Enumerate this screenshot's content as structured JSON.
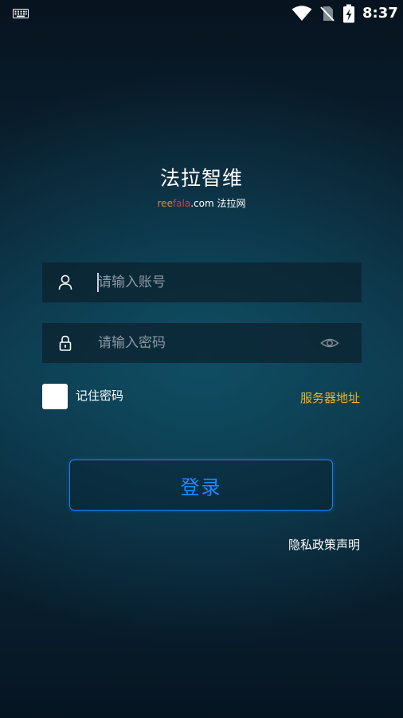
{
  "status_bar": {
    "time": "8:37",
    "icons": [
      "keyboard-icon",
      "wifi-icon",
      "no-sim-icon",
      "battery-charging-icon"
    ]
  },
  "header": {
    "title": "法拉智维",
    "subtitle_ree": "ree",
    "subtitle_fala": "fala",
    "subtitle_rest": ".com 法拉网"
  },
  "form": {
    "username": {
      "value": "",
      "placeholder": "请输入账号",
      "icon": "user-icon"
    },
    "password": {
      "value": "",
      "placeholder": "请输入密码",
      "icon": "lock-icon",
      "toggle_icon": "eye-icon"
    },
    "remember": {
      "label": "记住密码",
      "checked": false
    },
    "server_label": "服务器地址",
    "login_label": "登录",
    "privacy_label": "隐私政策声明"
  },
  "colors": {
    "accent_blue": "#1e88ff",
    "link_yellow": "#f3b320",
    "brand_orange": "#ef8a1c",
    "brand_red": "#e53b2e"
  }
}
